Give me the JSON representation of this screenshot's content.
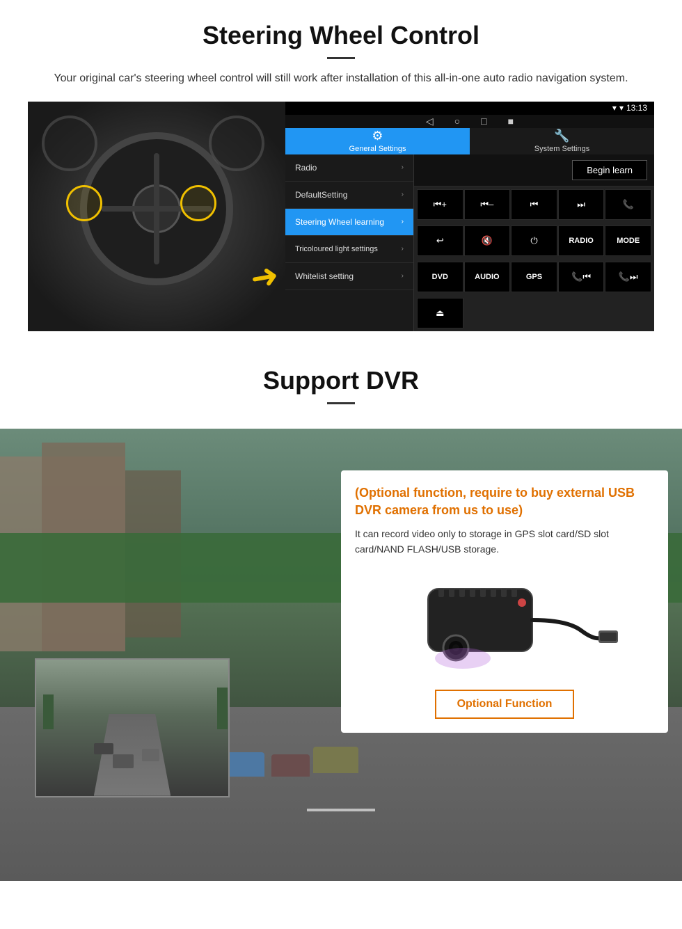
{
  "steering_section": {
    "title": "Steering Wheel Control",
    "subtitle": "Your original car's steering wheel control will still work after installation of this all-in-one auto radio navigation system.",
    "status_bar": {
      "time": "13:13",
      "icons": "▾ ▾"
    },
    "nav_buttons": [
      "◁",
      "○",
      "□",
      "■"
    ],
    "tabs": [
      {
        "label": "General Settings",
        "icon": "⚙",
        "active": true
      },
      {
        "label": "System Settings",
        "icon": "🔧",
        "active": false
      }
    ],
    "menu_items": [
      {
        "label": "Radio",
        "active": false
      },
      {
        "label": "DefaultSetting",
        "active": false
      },
      {
        "label": "Steering Wheel learning",
        "active": true
      },
      {
        "label": "Tricoloured light settings",
        "active": false
      },
      {
        "label": "Whitelist setting",
        "active": false
      }
    ],
    "begin_learn_label": "Begin learn",
    "control_buttons": [
      {
        "label": "⏮+",
        "row": 1
      },
      {
        "label": "⏮–",
        "row": 1
      },
      {
        "label": "⏮",
        "row": 1
      },
      {
        "label": "⏭",
        "row": 1
      },
      {
        "label": "📞",
        "row": 1
      },
      {
        "label": "↩",
        "row": 2
      },
      {
        "label": "🔇×",
        "row": 2
      },
      {
        "label": "⏻",
        "row": 2
      },
      {
        "label": "RADIO",
        "row": 2
      },
      {
        "label": "MODE",
        "row": 2
      },
      {
        "label": "DVD",
        "row": 3
      },
      {
        "label": "AUDIO",
        "row": 3
      },
      {
        "label": "GPS",
        "row": 3
      },
      {
        "label": "📞⏮",
        "row": 3
      },
      {
        "label": "⏭",
        "row": 3
      },
      {
        "label": "⏏",
        "row": 4
      }
    ]
  },
  "dvr_section": {
    "title": "Support DVR",
    "card": {
      "heading": "(Optional function, require to buy external USB DVR camera from us to use)",
      "description": "It can record video only to storage in GPS slot card/SD slot card/NAND FLASH/USB storage.",
      "optional_function_label": "Optional Function"
    }
  }
}
